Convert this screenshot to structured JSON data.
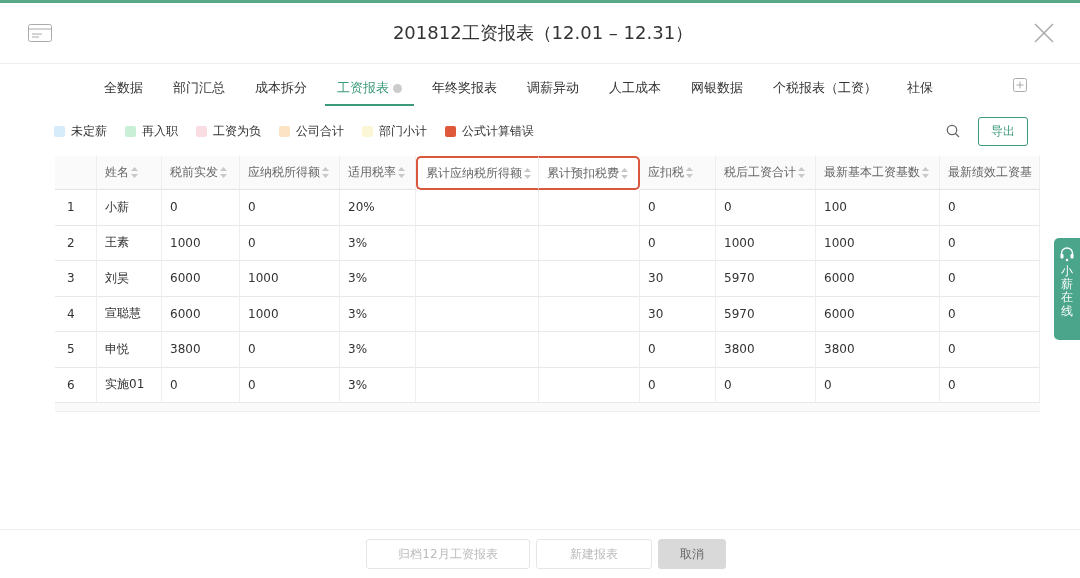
{
  "window": {
    "title": "201812工资报表（12.01 – 12.31）"
  },
  "tabs": [
    {
      "label": "全数据",
      "selected": false,
      "dot": false
    },
    {
      "label": "部门汇总",
      "selected": false,
      "dot": false
    },
    {
      "label": "成本拆分",
      "selected": false,
      "dot": false
    },
    {
      "label": "工资报表",
      "selected": true,
      "dot": true
    },
    {
      "label": "年终奖报表",
      "selected": false,
      "dot": false
    },
    {
      "label": "调薪异动",
      "selected": false,
      "dot": false
    },
    {
      "label": "人工成本",
      "selected": false,
      "dot": false
    },
    {
      "label": "网银数据",
      "selected": false,
      "dot": false
    },
    {
      "label": "个税报表（工资）",
      "selected": false,
      "dot": false
    },
    {
      "label": "社保",
      "selected": false,
      "dot": false
    }
  ],
  "legend": [
    {
      "label": "未定薪",
      "color": "#d6ecfa"
    },
    {
      "label": "再入职",
      "color": "#c9f0d6"
    },
    {
      "label": "工资为负",
      "color": "#f9dde3"
    },
    {
      "label": "公司合计",
      "color": "#fbe3c4"
    },
    {
      "label": "部门小计",
      "color": "#fbf6d6"
    },
    {
      "label": "公式计算错误",
      "color": "#e0583a"
    }
  ],
  "toolbar": {
    "export_button": "导出"
  },
  "table": {
    "columns": [
      {
        "flagged": false
      },
      {
        "label": "姓名",
        "flagged": false
      },
      {
        "label": "税前实发",
        "flagged": false
      },
      {
        "label": "应纳税所得额",
        "flagged": false
      },
      {
        "label": "适用税率",
        "flagged": false
      },
      {
        "label": "累计应纳税所得额",
        "flagged": true
      },
      {
        "label": "累计预扣税费",
        "flagged": true
      },
      {
        "label": "应扣税",
        "flagged": false
      },
      {
        "label": "税后工资合计",
        "flagged": false
      },
      {
        "label": "最新基本工资基数",
        "flagged": false
      },
      {
        "label": "最新绩效工资基",
        "flagged": false
      }
    ],
    "rows": [
      [
        "1",
        "小薪",
        "0",
        "0",
        "20%",
        "",
        "",
        "0",
        "0",
        "100",
        "0"
      ],
      [
        "2",
        "王素",
        "1000",
        "0",
        "3%",
        "",
        "",
        "0",
        "1000",
        "1000",
        "0"
      ],
      [
        "3",
        "刘昊",
        "6000",
        "1000",
        "3%",
        "",
        "",
        "30",
        "5970",
        "6000",
        "0"
      ],
      [
        "4",
        "宣聪慧",
        "6000",
        "1000",
        "3%",
        "",
        "",
        "30",
        "5970",
        "6000",
        "0"
      ],
      [
        "5",
        "申悦",
        "3800",
        "0",
        "3%",
        "",
        "",
        "0",
        "3800",
        "3800",
        "0"
      ],
      [
        "6",
        "实施01",
        "0",
        "0",
        "3%",
        "",
        "",
        "0",
        "0",
        "0",
        "0"
      ]
    ]
  },
  "side_tab": {
    "label": "小薪在线"
  },
  "footer_buttons": [
    {
      "label": "归档12月工资报表",
      "kind": "outline",
      "disabled": true
    },
    {
      "label": "新建报表",
      "kind": "outline",
      "disabled": true
    },
    {
      "label": "取消",
      "kind": "filled",
      "disabled": false
    }
  ]
}
